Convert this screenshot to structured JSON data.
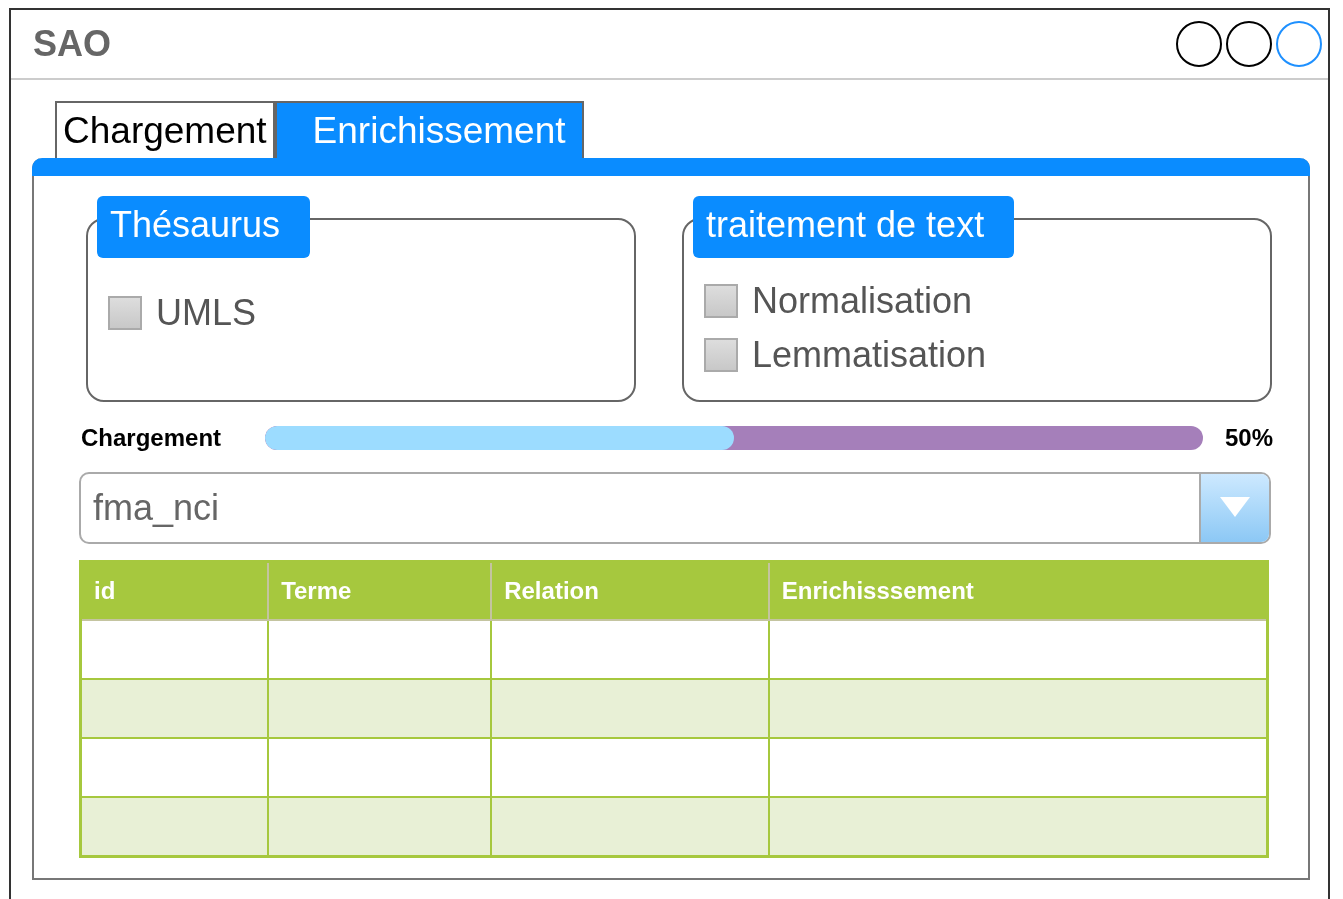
{
  "window": {
    "title": "SAO",
    "controls": [
      {
        "color": "#000000"
      },
      {
        "color": "#000000"
      },
      {
        "color": "#1e90ff"
      }
    ]
  },
  "tabs": [
    {
      "label": "Chargement",
      "selected": false
    },
    {
      "label": "Enrichissement",
      "selected": true
    }
  ],
  "groups": [
    {
      "title": "Thésaurus",
      "options": [
        {
          "label": "UMLS",
          "checked": false
        }
      ]
    },
    {
      "title": "traitement de text",
      "options": [
        {
          "label": "Normalisation",
          "checked": false
        },
        {
          "label": "Lemmatisation",
          "checked": false
        }
      ]
    }
  ],
  "progress": {
    "label": "Chargement",
    "level": 0.5,
    "reading": "50%"
  },
  "dropdown": {
    "value": "fma_nci"
  },
  "table": {
    "columns": [
      "id",
      "Terme",
      "Relation",
      "Enrichisssement"
    ],
    "rows": [
      {
        "shaded": false
      },
      {
        "shaded": true
      },
      {
        "shaded": false
      },
      {
        "shaded": true
      }
    ]
  }
}
